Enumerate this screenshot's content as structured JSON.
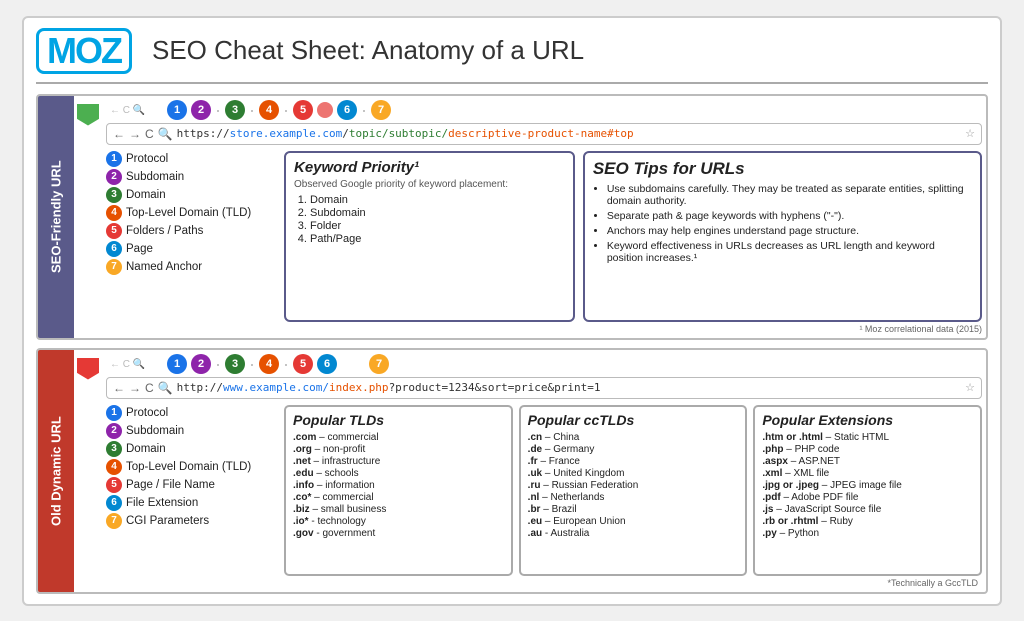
{
  "header": {
    "logo_text": "MOZ",
    "title": "SEO Cheat Sheet: Anatomy of a URL"
  },
  "seo_section": {
    "side_label": "SEO-Friendly URL",
    "url": {
      "plain_start": "https://",
      "blue_part": "store.example.com",
      "slash": "/",
      "green_part": "topic/subtopic/",
      "orange_part": "descriptive-product-name#top"
    },
    "numbers": [
      "1",
      "2",
      "3",
      "4",
      "5",
      "6",
      "7"
    ],
    "list": [
      {
        "num": "1",
        "label": "Protocol",
        "color": "nc1"
      },
      {
        "num": "2",
        "label": "Subdomain",
        "color": "nc2"
      },
      {
        "num": "3",
        "label": "Domain",
        "color": "nc3"
      },
      {
        "num": "4",
        "label": "Top-Level Domain (TLD)",
        "color": "nc4"
      },
      {
        "num": "5",
        "label": "Folders / Paths",
        "color": "nc5"
      },
      {
        "num": "6",
        "label": "Page",
        "color": "nc6"
      },
      {
        "num": "7",
        "label": "Named Anchor",
        "color": "nc7"
      }
    ],
    "keyword_box": {
      "title": "Keyword Priority¹",
      "subtitle": "Observed Google priority of keyword placement:",
      "items": [
        "1.  Domain",
        "2.  Subdomain",
        "3.  Folder",
        "4.  Path/Page"
      ]
    },
    "tips_box": {
      "title": "SEO Tips for URLs",
      "items": [
        "Use subdomains carefully. They may be treated as separate entities, splitting domain authority.",
        "Separate path & page keywords with hyphens (\"-\").",
        "Anchors may help engines understand page structure.",
        "Keyword effectiveness in URLs decreases as URL length and keyword position increases.¹"
      ]
    },
    "footnote": "¹ Moz correlational data (2015)"
  },
  "old_section": {
    "side_label": "Old Dynamic URL",
    "url": {
      "plain_start": "http://",
      "blue_part": "www.example.com/",
      "orange_part": "index.php",
      "plain_end": "?product=1234&sort=price&print=1"
    },
    "numbers": [
      "1",
      "2",
      "3",
      "4",
      "5",
      "6",
      "7"
    ],
    "list": [
      {
        "num": "1",
        "label": "Protocol",
        "color": "nc1"
      },
      {
        "num": "2",
        "label": "Subdomain",
        "color": "nc2"
      },
      {
        "num": "3",
        "label": "Domain",
        "color": "nc3"
      },
      {
        "num": "4",
        "label": "Top-Level Domain (TLD)",
        "color": "nc4"
      },
      {
        "num": "5",
        "label": "Page / File Name",
        "color": "nc5"
      },
      {
        "num": "6",
        "label": "File Extension",
        "color": "nc6"
      },
      {
        "num": "7",
        "label": "CGI Parameters",
        "color": "nc7"
      }
    ],
    "tlds": {
      "title": "Popular TLDs",
      "items": [
        {
          ".ext": ".com",
          "desc": "– commercial"
        },
        {
          ".ext": ".org",
          "desc": "– non-profit"
        },
        {
          ".ext": ".net",
          "desc": "– infrastructure"
        },
        {
          ".ext": ".edu",
          "desc": "– schools"
        },
        {
          ".ext": ".info",
          "desc": "– information"
        },
        {
          ".ext": ".co*",
          "desc": "– commercial"
        },
        {
          ".ext": ".biz",
          "desc": "– small business"
        },
        {
          ".ext": ".io*",
          "desc": "- technology"
        },
        {
          ".ext": ".gov",
          "desc": "- government"
        }
      ]
    },
    "cctlds": {
      "title": "Popular ccTLDs",
      "items": [
        {
          ".ext": ".cn",
          "desc": "– China"
        },
        {
          ".ext": ".de",
          "desc": "– Germany"
        },
        {
          ".ext": ".fr",
          "desc": "– France"
        },
        {
          ".ext": ".uk",
          "desc": "– United Kingdom"
        },
        {
          ".ext": ".ru",
          "desc": "– Russian Federation"
        },
        {
          ".ext": ".nl",
          "desc": "– Netherlands"
        },
        {
          ".ext": ".br",
          "desc": "– Brazil"
        },
        {
          ".ext": ".eu",
          "desc": "– European Union"
        },
        {
          ".ext": ".au",
          "desc": "- Australia"
        }
      ]
    },
    "extensions": {
      "title": "Popular Extensions",
      "items": [
        {
          ".ext": ".htm or .html",
          "desc": "– Static HTML"
        },
        {
          ".ext": ".php",
          "desc": "– PHP code"
        },
        {
          ".ext": ".aspx",
          "desc": "– ASP.NET"
        },
        {
          ".ext": ".xml",
          "desc": "– XML file"
        },
        {
          ".ext": ".jpg or .jpeg",
          "desc": "– JPEG image file"
        },
        {
          ".ext": ".pdf",
          "desc": "– Adobe PDF file"
        },
        {
          ".ext": ".js",
          "desc": "– JavaScript Source file"
        },
        {
          ".ext": ".rb or .rhtml",
          "desc": "– Ruby"
        },
        {
          ".ext": ".py",
          "desc": "– Python"
        }
      ]
    },
    "footnote": "*Technically a GccTLD"
  }
}
